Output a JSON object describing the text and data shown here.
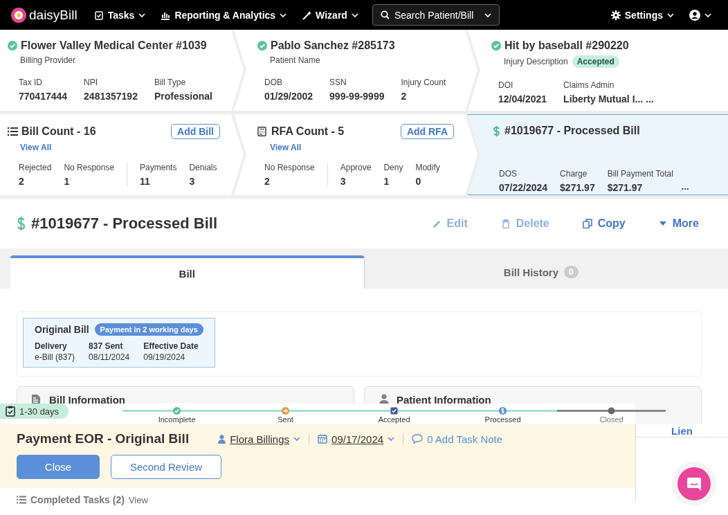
{
  "nav": {
    "brand": "daisyBill",
    "menus": [
      {
        "label": "Tasks"
      },
      {
        "label": "Reporting & Analytics"
      },
      {
        "label": "Wizard"
      }
    ],
    "search": {
      "placeholder": "Search Patient/Bill"
    },
    "settings": "Settings"
  },
  "summary_cards": [
    {
      "title": "Flower Valley Medical Center #1039",
      "verified": true,
      "subtitle": "Billing Provider",
      "fields": [
        {
          "label": "Tax ID",
          "value": "770417444"
        },
        {
          "label": "NPI",
          "value": "2481357192"
        },
        {
          "label": "Bill Type",
          "value": "Professional"
        }
      ]
    },
    {
      "title": "Pablo Sanchez #285173",
      "verified": true,
      "subtitle": "Patient Name",
      "fields": [
        {
          "label": "DOB",
          "value": "01/29/2002"
        },
        {
          "label": "SSN",
          "value": "999-99-9999"
        },
        {
          "label": "Injury Count",
          "value": "2"
        }
      ]
    },
    {
      "title": "Hit by baseball #290220",
      "verified": true,
      "subtitle": "Injury Description",
      "badge": "Accepted",
      "fields": [
        {
          "label": "DOI",
          "value": "12/04/2021"
        },
        {
          "label": "Claims Admin",
          "value": "Liberty Mutual I... ..."
        }
      ]
    }
  ],
  "count_cards": [
    {
      "kind": "list",
      "title": "Bill Count - 16",
      "selected": false,
      "link": "View All",
      "button": "Add Bill",
      "groups": [
        [
          {
            "label": "Rejected",
            "value": "2"
          },
          {
            "label": "No Response",
            "value": "1"
          }
        ],
        [
          {
            "label": "Payments",
            "value": "11"
          },
          {
            "label": "Denials",
            "value": "3"
          }
        ]
      ]
    },
    {
      "kind": "form",
      "title": "RFA Count - 5",
      "selected": false,
      "link": "View All",
      "button": "Add RFA",
      "groups": [
        [
          {
            "label": "No Response",
            "value": "2"
          }
        ],
        [
          {
            "label": "Approve",
            "value": "3"
          },
          {
            "label": "Deny",
            "value": "1"
          },
          {
            "label": "Modify",
            "value": "0"
          }
        ]
      ]
    },
    {
      "kind": "dollar",
      "title": "#1019677 - Processed Bill",
      "selected": true,
      "groups": [
        [
          {
            "label": "DOS",
            "value": "07/22/2024"
          },
          {
            "label": "Charge",
            "value": "$271.97"
          },
          {
            "label": "Bill Payment Total",
            "value": "$271.97"
          }
        ]
      ],
      "more": "..."
    }
  ],
  "page_title": "#1019677 - Processed Bill",
  "actions": [
    {
      "kind": "edit",
      "label": "Edit",
      "disabled": true
    },
    {
      "kind": "delete",
      "label": "Delete",
      "disabled": true
    },
    {
      "kind": "copy",
      "label": "Copy",
      "disabled": false
    },
    {
      "kind": "more",
      "label": "More",
      "disabled": false
    }
  ],
  "tabs": [
    {
      "label": "Bill",
      "selected": true
    },
    {
      "label": "Bill History",
      "selected": false,
      "count": "0"
    }
  ],
  "original_bill": {
    "title": "Original Bill",
    "badge": "Payment in 2 working days",
    "fields": [
      {
        "label": "Delivery",
        "value": "e-Bill (837)"
      },
      {
        "label": "837 Sent",
        "value": "08/11/2024"
      },
      {
        "label": "Effective Date",
        "value": "09/19/2024"
      }
    ]
  },
  "panels": [
    {
      "kind": "bill",
      "title": "Bill Information"
    },
    {
      "kind": "patient",
      "title": "Patient Information"
    }
  ],
  "task": {
    "age": "1-30 days",
    "steps": [
      {
        "kind": "check",
        "label": "Incomplete",
        "reached": true
      },
      {
        "kind": "arrow",
        "label": "Sent",
        "reached": true
      },
      {
        "kind": "box",
        "label": "Accepted",
        "reached": true
      },
      {
        "kind": "dollar",
        "label": "Processed",
        "reached": true
      },
      {
        "kind": "dot",
        "label": "Closed",
        "reached": false
      }
    ],
    "title": "Payment EOR - Original Bill",
    "assignee": "Flora Billings",
    "due": "09/17/2024",
    "note": "0 Add Task Note",
    "buttons": [
      {
        "label": "Close",
        "primary": true
      },
      {
        "label": "Second Review",
        "primary": false
      }
    ]
  },
  "side_tab": "Lien",
  "completed": {
    "label": "Completed Tasks (2)",
    "link": "View"
  }
}
